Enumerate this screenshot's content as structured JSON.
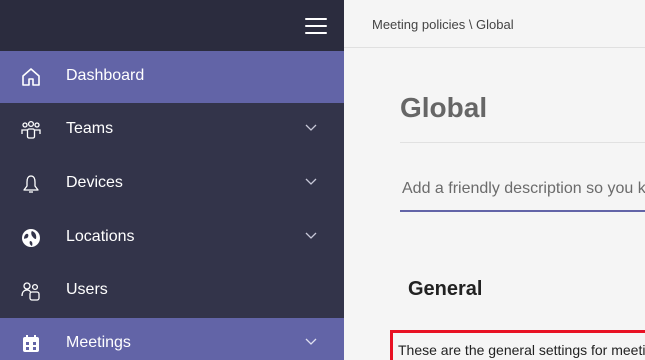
{
  "sidebar": {
    "items": [
      {
        "label": "Dashboard",
        "icon": "home-icon",
        "expandable": false,
        "active": true
      },
      {
        "label": "Teams",
        "icon": "teams-icon",
        "expandable": true,
        "active": false
      },
      {
        "label": "Devices",
        "icon": "devices-icon",
        "expandable": true,
        "active": false
      },
      {
        "label": "Locations",
        "icon": "globe-icon",
        "expandable": true,
        "active": false
      },
      {
        "label": "Users",
        "icon": "users-icon",
        "expandable": false,
        "active": false
      },
      {
        "label": "Meetings",
        "icon": "calendar-icon",
        "expandable": true,
        "active": true
      }
    ]
  },
  "breadcrumb": "Meeting policies \\ Global",
  "page": {
    "title": "Global",
    "description_placeholder": "Add a friendly description so you know why it was created",
    "section_title": "General",
    "section_text": "These are the general settings for meetings"
  },
  "colors": {
    "sidebar_bg": "#33344a",
    "sidebar_top_bg": "#2b2c3e",
    "active_bg": "#6264a7",
    "highlight_red": "#e81123"
  }
}
